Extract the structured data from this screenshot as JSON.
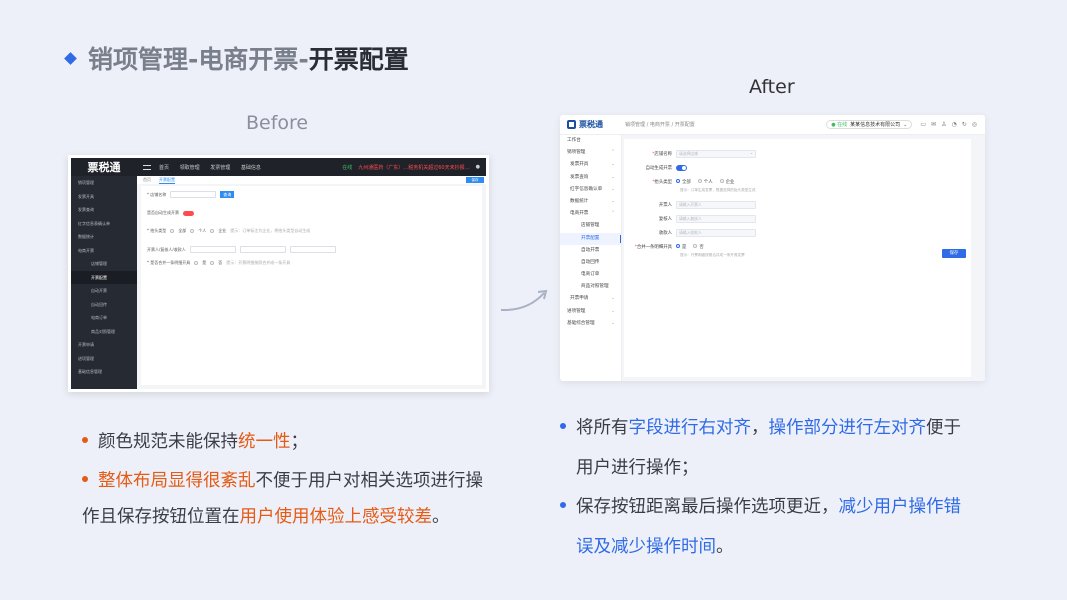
{
  "title": {
    "part1": "销项管理-电商开票-",
    "part2": "开票配置"
  },
  "captions": {
    "before": "Before",
    "after": "After"
  },
  "before": {
    "logo": "票税通",
    "nav": [
      "首页",
      "领取管理",
      "发票管理",
      "基础信息"
    ],
    "status_ok": "在线",
    "warn": "九州通医药（广东）…税务机关超过60天未抄报…",
    "sidebar": [
      "销项管理",
      "发票开具",
      "发票查询",
      "红字信息表确认单",
      "数据统计",
      "电商开票",
      "店铺管理",
      "开票配置",
      "自动开票",
      "自动回传",
      "电商订单",
      "商品对照管理",
      "开票申请",
      "进项管理",
      "基础信息管理"
    ],
    "tabs": [
      "首页",
      "开票配置"
    ],
    "top_button": "保存",
    "store_label": "* 店铺名称",
    "store_placeholder": "请选择",
    "query_button": "查询",
    "auto_label": "是否自动生成开票",
    "title_type_label": "* 抬头类型",
    "title_opts": [
      "全部",
      "个人",
      "企业"
    ],
    "title_hint": "提示：订单标注为企业，将抬头类型自动生成",
    "people_label": "开票人/复核人/收款人",
    "people_placeholders": [
      "请输入开票人",
      "请输入复核人",
      "请输入收款人"
    ],
    "merge_label": "* 是否合并一条明细开具",
    "merge_opts": [
      "是",
      "否"
    ],
    "merge_hint": "提示：开票明细按照合并成一条开具"
  },
  "after": {
    "logo": "票税通",
    "breadcrumb": "销项管理 / 电商开票 / 开票配置",
    "status": "● 在线",
    "company": "某某信息技术有限公司",
    "icons": [
      "message-icon",
      "mail-icon",
      "user-icon",
      "bell-icon",
      "refresh-icon",
      "settings-icon"
    ],
    "sidebar": [
      {
        "label": "工作台",
        "level": 0
      },
      {
        "label": "销项管理",
        "level": 0,
        "caret": "⌃"
      },
      {
        "label": "发票开具",
        "level": 1,
        "caret": "⌄"
      },
      {
        "label": "发票查询",
        "level": 1,
        "caret": "⌄"
      },
      {
        "label": "红字信息确认单",
        "level": 1,
        "caret": "⌄"
      },
      {
        "label": "数据统计",
        "level": 1,
        "caret": "⌄"
      },
      {
        "label": "电商开票",
        "level": 1,
        "caret": "⌃"
      },
      {
        "label": "店铺管理",
        "level": 2
      },
      {
        "label": "开票配置",
        "level": 2,
        "active": true
      },
      {
        "label": "自动开票",
        "level": 2
      },
      {
        "label": "自动回传",
        "level": 2
      },
      {
        "label": "电商订单",
        "level": 2
      },
      {
        "label": "商品对照管理",
        "level": 2
      },
      {
        "label": "开票申请",
        "level": 1,
        "caret": "⌄"
      },
      {
        "label": "进项管理",
        "level": 0,
        "caret": "⌄"
      },
      {
        "label": "基础综合管理",
        "level": 0,
        "caret": "⌄"
      }
    ],
    "form": {
      "store_label": "店铺名称",
      "store_placeholder": "请选择店铺",
      "auto_label": "自动生成开票",
      "title_type_label": "抬头类型",
      "title_opts": [
        "全部",
        "个人",
        "企业"
      ],
      "title_hint": "提示：订单生成发票，根据选择的抬头类型生成",
      "issuer_label": "开票人",
      "issuer_placeholder": "请输入开票人",
      "reviewer_label": "复核人",
      "reviewer_placeholder": "请输入复核人",
      "payee_label": "收款人",
      "payee_placeholder": "请输入收款人",
      "merge_label": "合并一条明细开具",
      "merge_opts": [
        "是",
        "否"
      ],
      "merge_hint": "提示：开票明细按照合并成一条开具发票",
      "save_button": "保存"
    }
  },
  "bullets_left": [
    {
      "a": "颜色规范未能保持",
      "b": "统一性",
      "c": "；"
    },
    {
      "a": "整体布局显得很紊乱",
      "b": "不便于用户对相关选项进行操",
      "c": "作且保存按钮位置在",
      "d": "用户使用体验上感受较差",
      "e": "。"
    }
  ],
  "bullets_right": [
    {
      "a": "将所有",
      "b": "字段进行右对齐",
      "c": "，",
      "d": "操作部分进行左对齐",
      "e": "便于",
      "f": "用户进行操作；"
    },
    {
      "a": "保存按钮距离最后操作选项更近，",
      "b": "减少用户操作错",
      "c": "误及减少操作时间",
      "d": "。"
    }
  ]
}
